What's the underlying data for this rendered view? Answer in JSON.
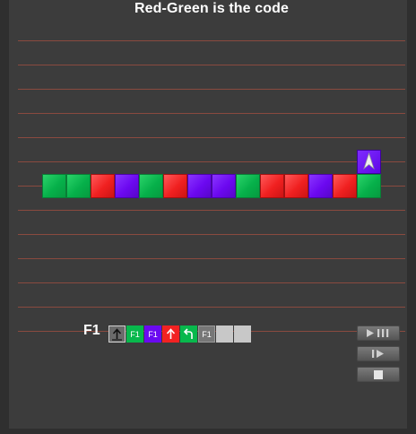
{
  "title": "Red-Green is the code",
  "colors": {
    "green": "#06b04a",
    "red": "#f02020",
    "purple": "#6b08f0",
    "gridline": "#8a4a3f",
    "background": "#3c3c3c"
  },
  "board": {
    "rows": 12,
    "cols": 16,
    "tiles": [
      {
        "row": 6,
        "col": 1,
        "color": "green"
      },
      {
        "row": 6,
        "col": 2,
        "color": "green"
      },
      {
        "row": 6,
        "col": 3,
        "color": "red"
      },
      {
        "row": 6,
        "col": 4,
        "color": "purple"
      },
      {
        "row": 6,
        "col": 5,
        "color": "green"
      },
      {
        "row": 6,
        "col": 6,
        "color": "red"
      },
      {
        "row": 6,
        "col": 7,
        "color": "purple"
      },
      {
        "row": 6,
        "col": 8,
        "color": "purple"
      },
      {
        "row": 6,
        "col": 9,
        "color": "green"
      },
      {
        "row": 6,
        "col": 10,
        "color": "red"
      },
      {
        "row": 6,
        "col": 11,
        "color": "red"
      },
      {
        "row": 6,
        "col": 12,
        "color": "purple"
      },
      {
        "row": 6,
        "col": 13,
        "color": "red"
      },
      {
        "row": 6,
        "col": 14,
        "color": "green"
      },
      {
        "row": 5,
        "col": 14,
        "color": "purple"
      }
    ],
    "ship": {
      "row": 5,
      "col": 14,
      "direction": "up",
      "icon": "ship-arrow-icon"
    }
  },
  "program": {
    "function_label": "F1",
    "slots": [
      {
        "kind": "gray-cond",
        "text": "",
        "icon": "forward-arrow-icon"
      },
      {
        "kind": "green",
        "text": "F1",
        "icon": ""
      },
      {
        "kind": "purple",
        "text": "F1",
        "icon": ""
      },
      {
        "kind": "red",
        "text": "",
        "icon": "forward-arrow-icon"
      },
      {
        "kind": "green",
        "text": "",
        "icon": "turn-left-icon"
      },
      {
        "kind": "gray",
        "text": "F1",
        "icon": ""
      },
      {
        "kind": "empty",
        "text": "",
        "icon": ""
      },
      {
        "kind": "empty",
        "text": "",
        "icon": ""
      }
    ]
  },
  "controls": {
    "play_pause_icon": "play-pause-icon",
    "step_icon": "step-icon",
    "stop_icon": "stop-icon"
  }
}
